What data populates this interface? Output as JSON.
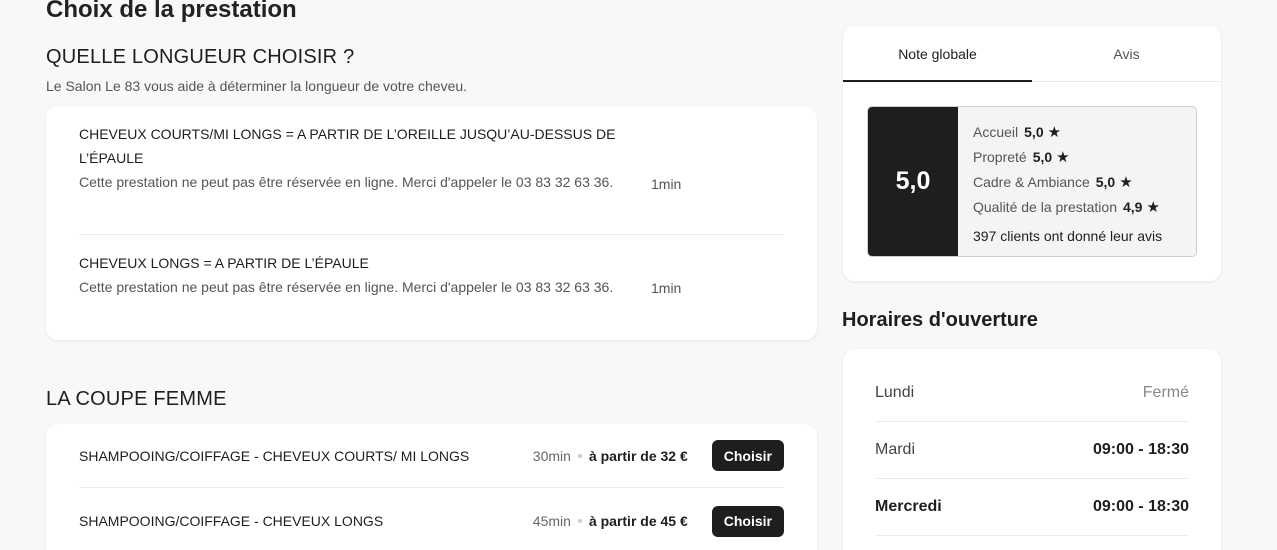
{
  "page_title": "Choix de la prestation",
  "info_section": {
    "title": "QUELLE LONGUEUR CHOISIR ?",
    "subtitle": "Le Salon Le 83 vous aide à déterminer la longueur de votre cheveu.",
    "services": [
      {
        "name": "CHEVEUX COURTS/MI LONGS = A PARTIR DE L’OREILLE JUSQU’AU-DESSUS DE L’ÉPAULE",
        "description": "Cette prestation ne peut pas être réservée en ligne. Merci d'appeler le 03 83 32 63 36.",
        "duration": "1min"
      },
      {
        "name": "CHEVEUX LONGS = A PARTIR DE L’ÉPAULE",
        "description": "Cette prestation ne peut pas être réservée en ligne. Merci d'appeler le 03 83 32 63 36.",
        "duration": "1min"
      }
    ]
  },
  "coupe_section": {
    "title": "LA COUPE FEMME",
    "services": [
      {
        "name": "SHAMPOOING/COIFFAGE - CHEVEUX COURTS/ MI LONGS",
        "duration": "30min",
        "price": "à partir de 32 €",
        "button": "Choisir"
      },
      {
        "name": "SHAMPOOING/COIFFAGE - CHEVEUX LONGS",
        "duration": "45min",
        "price": "à partir de 45 €",
        "button": "Choisir"
      }
    ]
  },
  "rating": {
    "tabs": [
      "Note globale",
      "Avis"
    ],
    "active_tab": 0,
    "overall": "5,0",
    "items": [
      {
        "label": "Accueil",
        "value": "5,0"
      },
      {
        "label": "Propreté",
        "value": "5,0"
      },
      {
        "label": "Cadre & Ambiance",
        "value": "5,0"
      },
      {
        "label": "Qualité de la prestation",
        "value": "4,9"
      }
    ],
    "star": "★",
    "count_text": "397 clients ont donné leur avis"
  },
  "hours": {
    "title": "Horaires d'ouverture",
    "days": [
      {
        "day": "Lundi",
        "time": "Fermé"
      },
      {
        "day": "Mardi",
        "time": "09:00 - 18:30"
      },
      {
        "day": "Mercredi",
        "time": "09:00 - 18:30"
      }
    ]
  }
}
